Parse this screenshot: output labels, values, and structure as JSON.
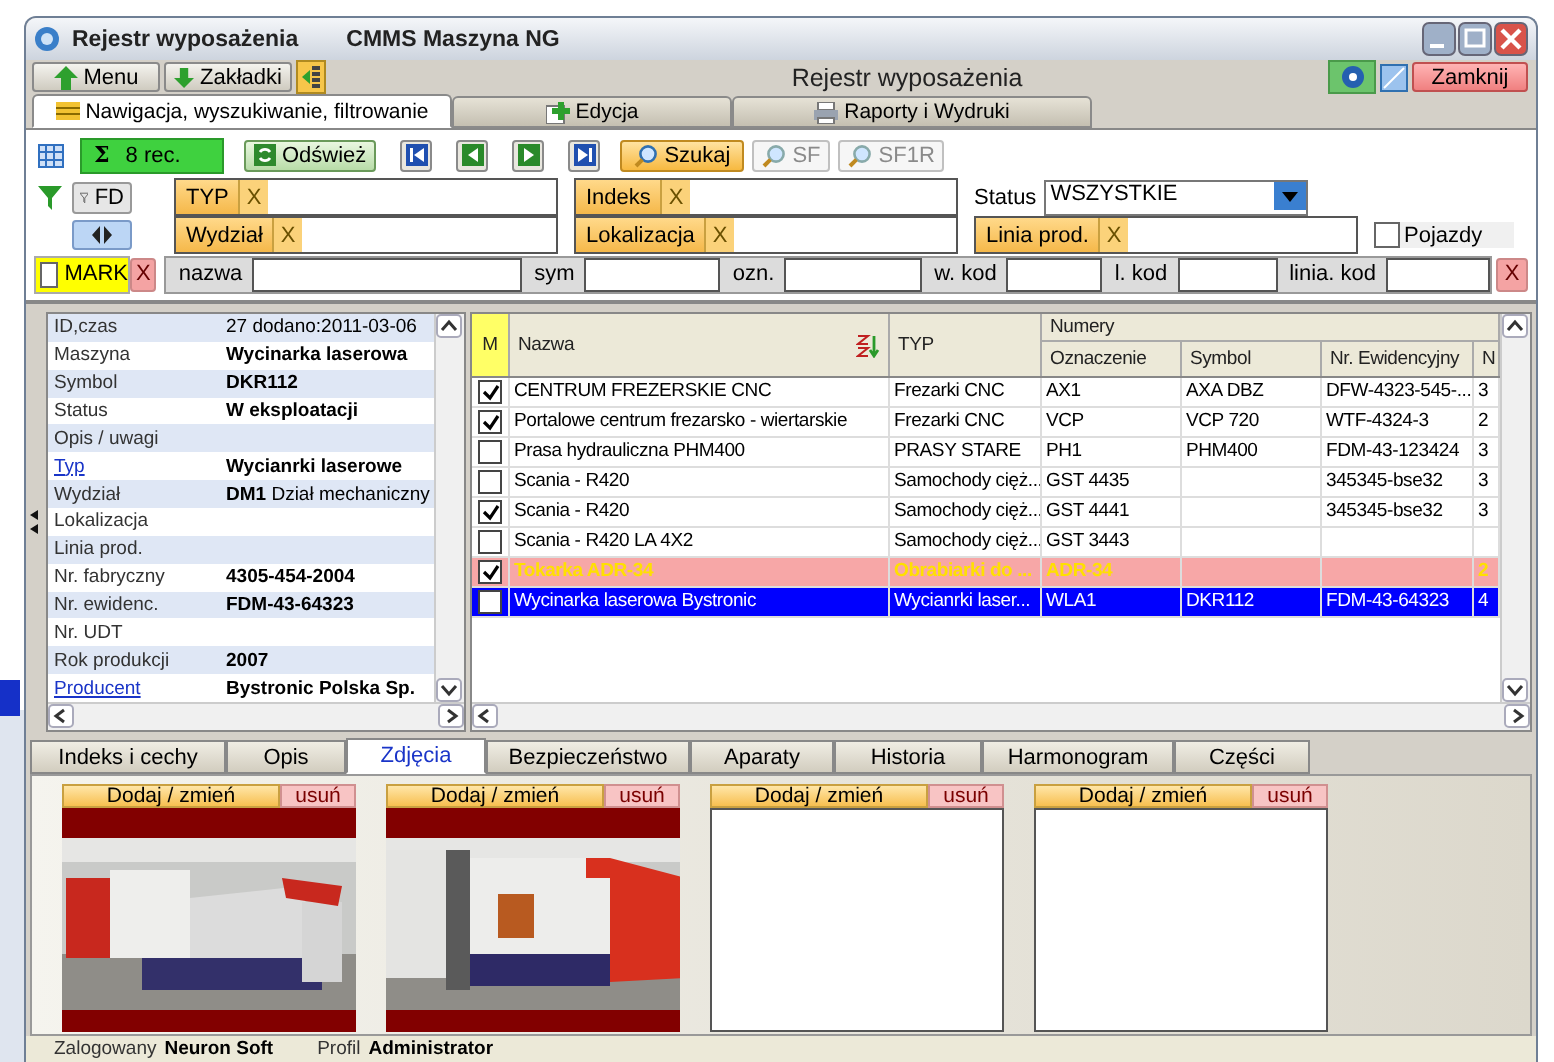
{
  "window": {
    "title": "Rejestr wyposażenia",
    "app": "CMMS Maszyna NG"
  },
  "top_bar": {
    "buttons": [
      {
        "label": "Menu",
        "kind": "up"
      },
      {
        "label": "Zakładki",
        "kind": "down"
      }
    ],
    "center_title": "Rejestr wyposażenia",
    "close_button": "Zamknij"
  },
  "main_tabs": [
    {
      "label": "Nawigacja, wyszukiwanie, filtrowanie",
      "selected": true
    },
    {
      "label": "Edycja",
      "selected": false
    },
    {
      "label": "Raporty i Wydruki",
      "selected": false
    }
  ],
  "toolbar": {
    "sigma": "Σ",
    "record_count": "8 rec.",
    "refresh": "Odśwież",
    "search": "Szukaj",
    "extra_buttons": [
      {
        "label": "SF",
        "disabled": true
      },
      {
        "label": "SF1R",
        "disabled": true
      }
    ]
  },
  "filter_rows": [
    [
      {
        "kind": "fd",
        "label": "FD"
      },
      {
        "kind": "chip",
        "label": "TYP",
        "clear": "X"
      },
      {
        "kind": "chip",
        "label": "Indeks",
        "clear": "X"
      },
      {
        "kind": "status",
        "label": "Status",
        "value": "WSZYSTKIE"
      }
    ],
    [
      {
        "kind": "move"
      },
      {
        "kind": "chip",
        "label": "Wydział",
        "clear": "X"
      },
      {
        "kind": "chip",
        "label": "Lokalizacja",
        "clear": "X"
      },
      {
        "kind": "chip",
        "label": "Linia prod.",
        "clear": "X"
      },
      {
        "kind": "checkbox",
        "label": "Pojazdy",
        "checked": false
      }
    ]
  ],
  "mark_row": {
    "mark": {
      "label": "MARK",
      "checked": false
    },
    "clear": "X",
    "fields": [
      "nazwa",
      "sym",
      "ozn.",
      "w. kod",
      "l. kod",
      "linia. kod"
    ],
    "clear_all": "X"
  },
  "details": [
    {
      "label": "ID,czas",
      "value": "27 dodano:2011-03-06",
      "link": false
    },
    {
      "label": "Maszyna",
      "value": "**Wycinarka laserowa**",
      "link": false
    },
    {
      "label": "Symbol",
      "value": "**DKR112**",
      "link": false
    },
    {
      "label": "Status",
      "value": "**W eksploatacji**",
      "link": false
    },
    {
      "label": "Opis / uwagi",
      "link": false
    },
    {
      "label": "Typ",
      "value": "**Wycianrki laserowe**",
      "link": true
    },
    {
      "label": "Wydział",
      "value": "**DM1** Dział mechaniczny",
      "link": false
    },
    {
      "label": "Lokalizacja",
      "link": false
    },
    {
      "label": "Linia prod.",
      "link": false
    },
    {
      "label": "Nr. fabryczny",
      "value": "**4305-454-2004**",
      "link": false
    },
    {
      "label": "Nr. ewidenc.",
      "value": "**FDM-43-64323**",
      "link": false
    },
    {
      "label": "Nr. UDT",
      "link": false
    },
    {
      "label": "Rok produkcji",
      "value": "**2007**",
      "link": false
    },
    {
      "label": "Producent",
      "value": "**Bystronic Polska Sp.**",
      "link": true
    }
  ],
  "grid": {
    "mark_column": "M",
    "columns": [
      "Nazwa",
      "TYP"
    ],
    "group": "Numery",
    "group_columns": [
      "Oznaczenie",
      "Symbol",
      "Nr. Ewidencyjny",
      "N"
    ],
    "rows": [
      {
        "checked": true,
        "selected": false,
        "flagged": false,
        "cells": [
          "CENTRUM FREZERSKIE CNC",
          "Frezarki CNC",
          "AX1",
          "AXA DBZ",
          "DFW-4323-545-...",
          "3"
        ]
      },
      {
        "checked": true,
        "selected": false,
        "flagged": false,
        "cells": [
          "Portalowe centrum frezarsko - wiertarskie",
          "Frezarki CNC",
          "VCP",
          "VCP 720",
          "WTF-4324-3",
          "2"
        ]
      },
      {
        "checked": false,
        "selected": false,
        "flagged": false,
        "cells": [
          "Prasa hydrauliczna PHM400",
          "PRASY STARE",
          "PH1",
          "PHM400",
          "FDM-43-123424",
          "3"
        ]
      },
      {
        "checked": false,
        "selected": false,
        "flagged": false,
        "cells": [
          "Scania - R420",
          "Samochody cięż...",
          "GST 4435",
          "",
          "345345-bse32",
          "3"
        ]
      },
      {
        "checked": true,
        "selected": false,
        "flagged": false,
        "cells": [
          "Scania - R420",
          "Samochody cięż...",
          "GST 4441",
          "",
          "345345-bse32",
          "3"
        ]
      },
      {
        "checked": false,
        "selected": false,
        "flagged": false,
        "cells": [
          "Scania - R420 LA 4X2",
          "Samochody cięż...",
          "GST 3443",
          "",
          "",
          ""
        ]
      },
      {
        "checked": true,
        "selected": false,
        "flagged": true,
        "cells": [
          "Tokarka ADR-34",
          "Obrabiarki do ...",
          "ADR-34",
          "",
          "",
          "2"
        ]
      },
      {
        "checked": false,
        "selected": true,
        "flagged": false,
        "cells": [
          "Wycinarka laserowa Bystronic",
          "Wycianrki laser...",
          "WLA1",
          "DKR112",
          "FDM-43-64323",
          "4"
        ]
      }
    ]
  },
  "bottom_tabs": [
    {
      "label": "Indeks i cechy",
      "selected": false
    },
    {
      "label": "Opis",
      "selected": false
    },
    {
      "label": "Zdjęcia",
      "selected": true
    },
    {
      "label": "Bezpieczeństwo",
      "selected": false
    },
    {
      "label": "Aparaty",
      "selected": false
    },
    {
      "label": "Historia",
      "selected": false
    },
    {
      "label": "Harmonogram",
      "selected": false
    },
    {
      "label": "Części",
      "selected": false
    }
  ],
  "photos": [
    {
      "add": "Dodaj / zmień",
      "remove": "usuń",
      "kind": "picture"
    },
    {
      "add": "Dodaj / zmień",
      "remove": "usuń",
      "kind": "picture"
    },
    {
      "add": "Dodaj / zmień",
      "remove": "usuń",
      "kind": "empty"
    },
    {
      "add": "Dodaj / zmień",
      "remove": "usuń",
      "kind": "empty"
    }
  ],
  "status_bar": [
    {
      "label": "Zalogowany",
      "value": "Neuron Soft"
    },
    {
      "label": "Profil",
      "value": "Administrator"
    }
  ]
}
